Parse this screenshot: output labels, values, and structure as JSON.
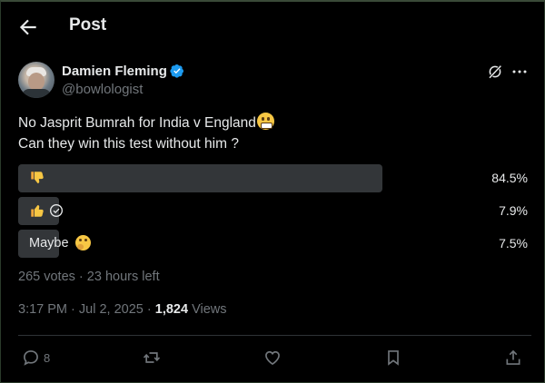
{
  "header": {
    "title": "Post"
  },
  "author": {
    "name": "Damien Fleming",
    "handle": "@bowlologist"
  },
  "tweet": {
    "line1": "No Jasprit Bumrah for India v England",
    "line2": "Can they win this test without him ?"
  },
  "poll": {
    "options": [
      {
        "label": "",
        "icon": "thumbs-down-icon",
        "percent": "84.5%",
        "fill": 0.845
      },
      {
        "label": "",
        "icon": "thumbs-up-icon",
        "percent": "7.9%",
        "fill": 0.079,
        "voted": true
      },
      {
        "label": "Maybe",
        "icon": "thinking-face-icon",
        "percent": "7.5%",
        "fill": 0.075
      }
    ],
    "votes": "265 votes",
    "time_left": "23 hours left",
    "separator": "·"
  },
  "meta": {
    "time": "3:17 PM",
    "date": "Jul 2, 2025",
    "views_count": "1,824",
    "views_label": "Views",
    "separator": "·"
  },
  "actions": {
    "reply_count": "8"
  },
  "colors": {
    "background": "#000000",
    "text": "#e7e9ea",
    "muted": "#71767b",
    "poll_bar": "#333639",
    "verified": "#1d9bf0"
  }
}
